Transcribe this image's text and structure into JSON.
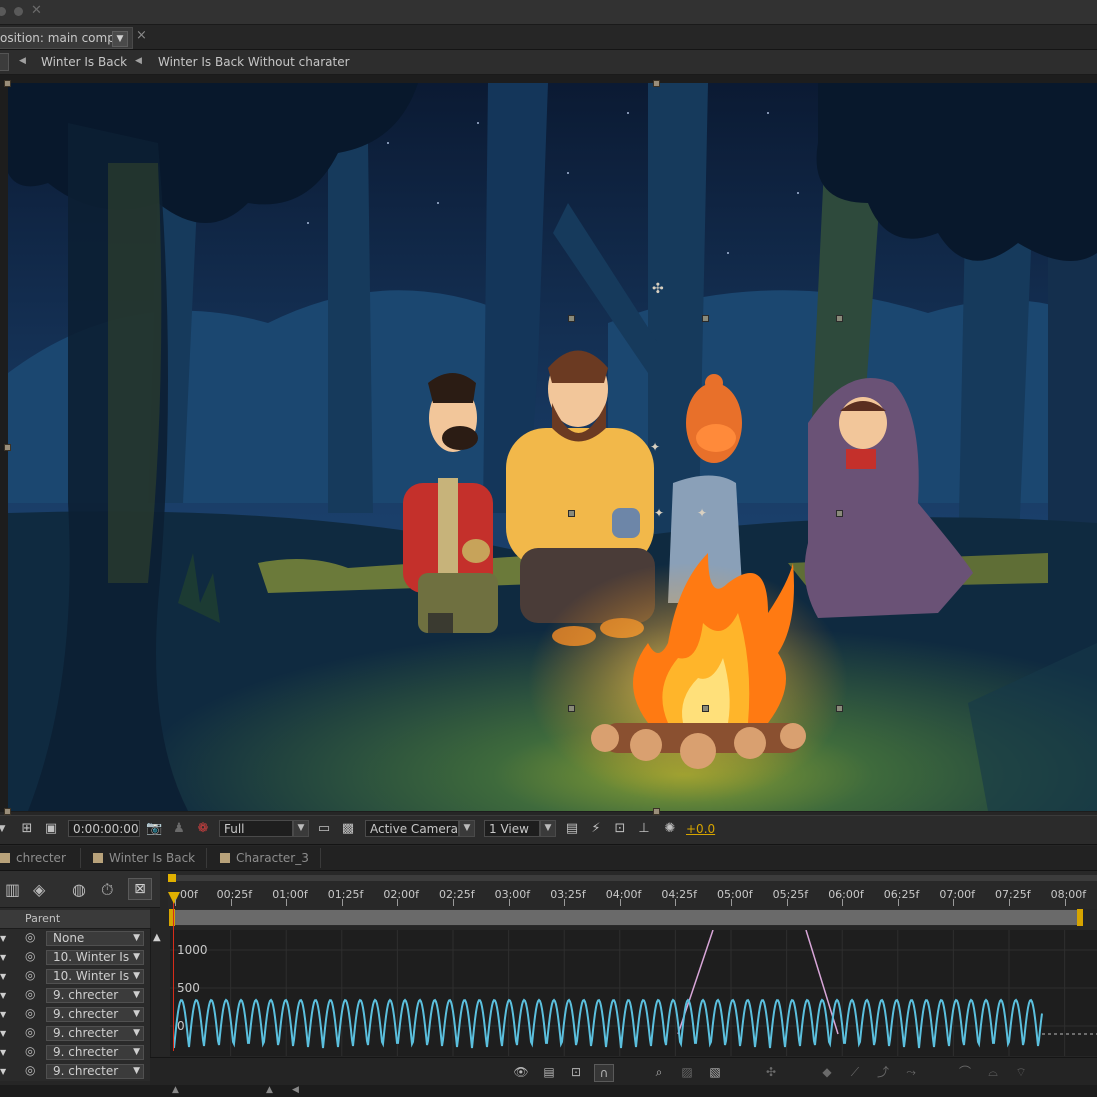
{
  "composition_tab": {
    "title": "osition: main comp",
    "close_glyph": "×"
  },
  "breadcrumbs": [
    "Winter Is Back",
    "Winter Is Back Without charater"
  ],
  "viewer_toolbar": {
    "timecode": "0:00:00:00",
    "resolution": "Full",
    "camera": "Active Camera",
    "views": "1 View",
    "exposure": "+0.0"
  },
  "timeline_tabs": [
    "chrecter",
    "Winter Is Back",
    "Character_3"
  ],
  "layer_panel": {
    "parent_header": "Parent",
    "layers": [
      {
        "parent": "None"
      },
      {
        "parent": "10. Winter Is"
      },
      {
        "parent": "10. Winter Is"
      },
      {
        "parent": "9. chrecter"
      },
      {
        "parent": "9. chrecter"
      },
      {
        "parent": "9. chrecter"
      },
      {
        "parent": "9. chrecter"
      },
      {
        "parent": "9. chrecter"
      }
    ]
  },
  "time_ruler": {
    "labels": [
      "00f",
      "00:25f",
      "01:00f",
      "01:25f",
      "02:00f",
      "02:25f",
      "03:00f",
      "03:25f",
      "04:00f",
      "04:25f",
      "05:00f",
      "05:25f",
      "06:00f",
      "06:25f",
      "07:00f",
      "07:25f",
      "08:00f"
    ]
  },
  "graph_editor": {
    "y_labels": [
      "1000",
      "500",
      "0"
    ],
    "curve_color": "#5bc0de",
    "secondary_curve_color": "#d8a6d8",
    "playhead_color": "#d62c1a"
  },
  "colors": {
    "accent": "#d6a400",
    "sky_top": "#0b1a33",
    "sky_bottom": "#1a3f6a",
    "fire": "#ff9a1a"
  }
}
